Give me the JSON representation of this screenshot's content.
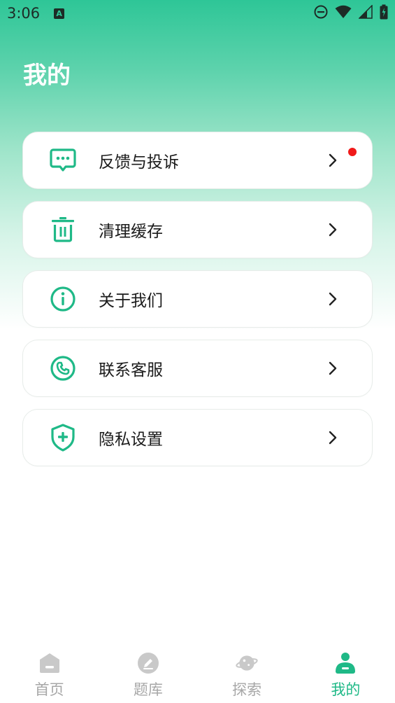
{
  "status_bar": {
    "time": "3:06",
    "notification_letter": "A"
  },
  "header": {
    "title": "我的"
  },
  "menu": [
    {
      "label": "反馈与投诉",
      "icon": "chat-bubble-icon",
      "has_badge": true
    },
    {
      "label": "清理缓存",
      "icon": "trash-icon",
      "has_badge": false
    },
    {
      "label": "关于我们",
      "icon": "info-icon",
      "has_badge": false
    },
    {
      "label": "联系客服",
      "icon": "phone-icon",
      "has_badge": false
    },
    {
      "label": "隐私设置",
      "icon": "shield-plus-icon",
      "has_badge": false
    }
  ],
  "tabs": [
    {
      "label": "首页",
      "icon": "home-icon",
      "active": false
    },
    {
      "label": "题库",
      "icon": "pencil-icon",
      "active": false
    },
    {
      "label": "探索",
      "icon": "planet-icon",
      "active": false
    },
    {
      "label": "我的",
      "icon": "user-icon",
      "active": true
    }
  ],
  "colors": {
    "accent": "#1fb987",
    "header_gradient_top": "#2ec697",
    "badge": "#f01a1a",
    "tab_inactive": "#a7a7a7"
  }
}
